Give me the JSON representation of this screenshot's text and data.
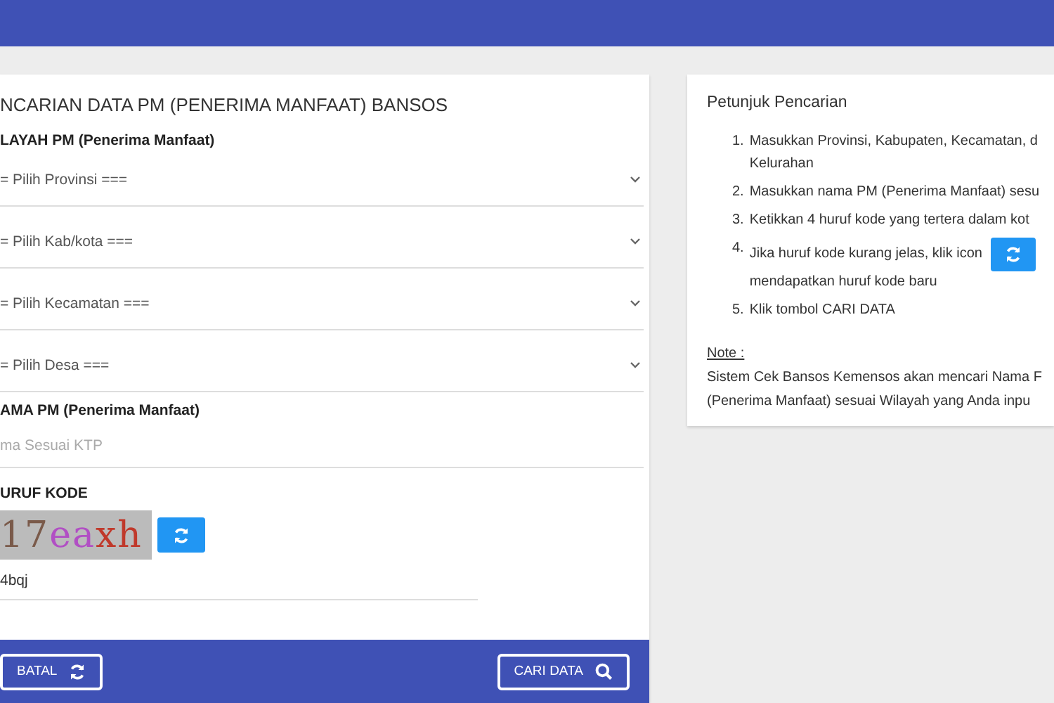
{
  "form": {
    "title": "NCARIAN DATA PM (PENERIMA MANFAAT) BANSOS",
    "region_label": "LAYAH PM (Penerima Manfaat)",
    "selects": [
      {
        "placeholder": "= Pilih Provinsi ==="
      },
      {
        "placeholder": "= Pilih Kab/kota ==="
      },
      {
        "placeholder": "= Pilih Kecamatan ==="
      },
      {
        "placeholder": "= Pilih Desa ==="
      }
    ],
    "name_label": "AMA PM (Penerima Manfaat)",
    "name_field": {
      "placeholder": "ma Sesuai KTP"
    },
    "code_label": "URUF KODE",
    "captcha": "17eaxh",
    "code_field": {
      "value": "4bqj"
    },
    "buttons": [
      {
        "label": "BATAL",
        "kind": "reset"
      },
      {
        "label": "CARI DATA",
        "kind": "search"
      }
    ]
  },
  "help": {
    "title": "Petunjuk Pencarian",
    "steps": [
      {
        "number": "1.",
        "lines": [
          "Masukkan Provinsi, Kabupaten, Kecamatan, d",
          "Kelurahan"
        ],
        "kind": "text"
      },
      {
        "number": "2.",
        "lines": [
          "Masukkan nama PM (Penerima Manfaat) sesu"
        ],
        "kind": "text"
      },
      {
        "number": "3.",
        "lines": [
          "Ketikkan 4 huruf kode yang tertera dalam kot"
        ],
        "kind": "text"
      },
      {
        "number": "4.",
        "lines": [
          "Jika huruf kode kurang jelas, klik icon",
          "mendapatkan huruf kode baru"
        ],
        "kind": "icon"
      },
      {
        "number": "5.",
        "lines": [
          "Klik tombol CARI DATA"
        ],
        "kind": "text"
      }
    ],
    "note_label": "Note :",
    "note_lines": [
      "Sistem Cek Bansos Kemensos akan mencari Nama F",
      "(Penerima Manfaat) sesuai Wilayah yang Anda inpu"
    ]
  }
}
